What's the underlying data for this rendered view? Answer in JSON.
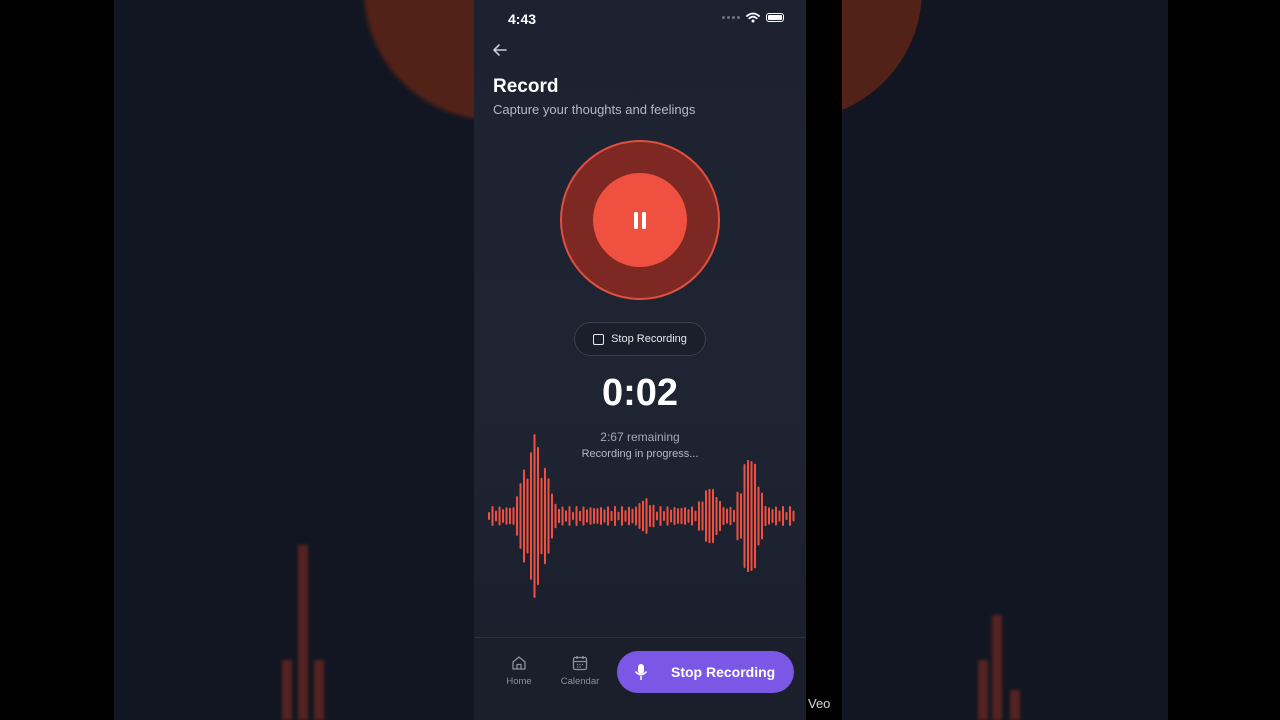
{
  "status_bar": {
    "time": "4:43"
  },
  "header": {
    "title": "Record",
    "subtitle": "Capture your thoughts and feelings"
  },
  "recorder": {
    "stop_pill_label": "Stop Recording",
    "timer": "0:02",
    "remaining": "2:67 remaining",
    "status": "Recording in progress..."
  },
  "bottom_nav": {
    "home_label": "Home",
    "calendar_label": "Calendar",
    "cta_label": "Stop Recording"
  },
  "watermark": "Veo",
  "colors": {
    "accent_red": "#f0503f",
    "accent_purple": "#7b57e6",
    "background": "#1d2230"
  },
  "icons": [
    "back-arrow-icon",
    "wifi-icon",
    "battery-icon",
    "pause-icon",
    "stop-icon",
    "home-icon",
    "calendar-icon",
    "microphone-icon"
  ]
}
